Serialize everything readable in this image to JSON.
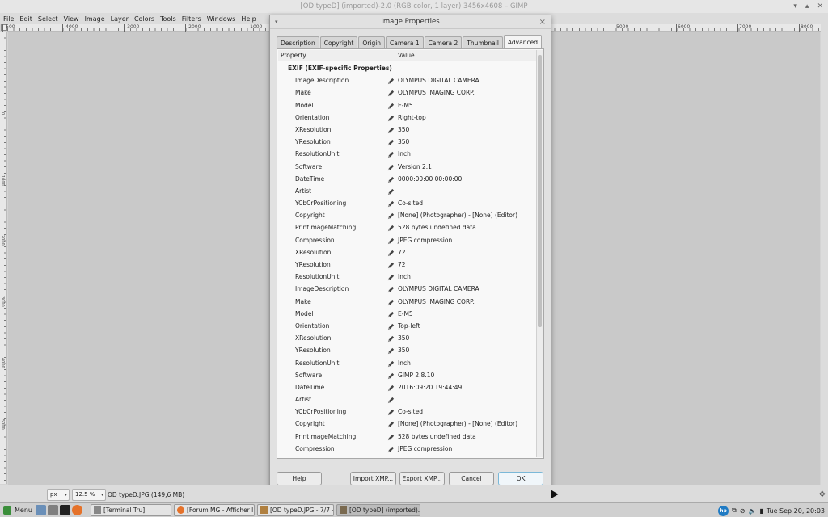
{
  "window": {
    "title": "[OD typeD] (imported)-2.0 (RGB color, 1 layer) 3456x4608 – GIMP",
    "controls": [
      "▾",
      "▴",
      "✕"
    ]
  },
  "menubar": [
    "File",
    "Edit",
    "Select",
    "View",
    "Image",
    "Layer",
    "Colors",
    "Tools",
    "Filters",
    "Windows",
    "Help"
  ],
  "rulers": {
    "h_ticks": [
      "-500",
      "-4000",
      "-3000",
      "-2000",
      "-1000",
      "5000",
      "6000",
      "7000",
      "8000"
    ],
    "v_ticks": [
      "0",
      "1000",
      "2000",
      "3000",
      "4000",
      "5000"
    ]
  },
  "dialog": {
    "title": "Image Properties",
    "tabs": [
      "Description",
      "Copyright",
      "Origin",
      "Camera 1",
      "Camera 2",
      "Thumbnail",
      "Advanced"
    ],
    "active_tab": "Advanced",
    "columns": {
      "property": "Property",
      "value": "Value"
    },
    "group": "EXIF (EXIF-specific Properties)",
    "rows": [
      {
        "p": "ImageDescription",
        "v": "OLYMPUS DIGITAL CAMERA"
      },
      {
        "p": "Make",
        "v": "OLYMPUS IMAGING CORP."
      },
      {
        "p": "Model",
        "v": "E-M5"
      },
      {
        "p": "Orientation",
        "v": "Right-top"
      },
      {
        "p": "XResolution",
        "v": "350"
      },
      {
        "p": "YResolution",
        "v": "350"
      },
      {
        "p": "ResolutionUnit",
        "v": "Inch"
      },
      {
        "p": "Software",
        "v": "Version 2.1"
      },
      {
        "p": "DateTime",
        "v": "0000:00:00 00:00:00"
      },
      {
        "p": "Artist",
        "v": ""
      },
      {
        "p": "YCbCrPositioning",
        "v": "Co-sited"
      },
      {
        "p": "Copyright",
        "v": "[None] (Photographer) - [None] (Editor)"
      },
      {
        "p": "PrintImageMatching",
        "v": "528 bytes undefined data"
      },
      {
        "p": "Compression",
        "v": "JPEG compression"
      },
      {
        "p": "XResolution",
        "v": "72"
      },
      {
        "p": "YResolution",
        "v": "72"
      },
      {
        "p": "ResolutionUnit",
        "v": "Inch"
      },
      {
        "p": "ImageDescription",
        "v": "OLYMPUS DIGITAL CAMERA"
      },
      {
        "p": "Make",
        "v": "OLYMPUS IMAGING CORP."
      },
      {
        "p": "Model",
        "v": "E-M5"
      },
      {
        "p": "Orientation",
        "v": "Top-left"
      },
      {
        "p": "XResolution",
        "v": "350"
      },
      {
        "p": "YResolution",
        "v": "350"
      },
      {
        "p": "ResolutionUnit",
        "v": "Inch"
      },
      {
        "p": "Software",
        "v": "GIMP 2.8.10"
      },
      {
        "p": "DateTime",
        "v": "2016:09:20 19:44:49"
      },
      {
        "p": "Artist",
        "v": ""
      },
      {
        "p": "YCbCrPositioning",
        "v": "Co-sited"
      },
      {
        "p": "Copyright",
        "v": "[None] (Photographer) - [None] (Editor)"
      },
      {
        "p": "PrintImageMatching",
        "v": "528 bytes undefined data"
      },
      {
        "p": "Compression",
        "v": "JPEG compression"
      }
    ],
    "buttons": {
      "help": "Help",
      "import": "Import XMP...",
      "export": "Export XMP...",
      "cancel": "Cancel",
      "ok": "OK"
    }
  },
  "status": {
    "unit": "px",
    "zoom": "12.5 %",
    "text": "OD typeD.JPG (149,6 MB)"
  },
  "taskbar": {
    "menu_label": "Menu",
    "tasks": [
      {
        "label": "[Terminal Tru]",
        "active": false
      },
      {
        "label": "[Forum MG - Afficher l...",
        "active": false
      },
      {
        "label": "[OD typeD.JPG - 7/7 - ...",
        "active": false
      },
      {
        "label": "[OD typeD] (imported)...",
        "active": true
      }
    ],
    "clock": "Tue Sep 20, 20:03",
    "hp_label": "hp"
  },
  "colors": {
    "accent_ok": "#7ab8d8",
    "taskbar": "#d0d0d0",
    "canvas": "#c9c9c9"
  }
}
